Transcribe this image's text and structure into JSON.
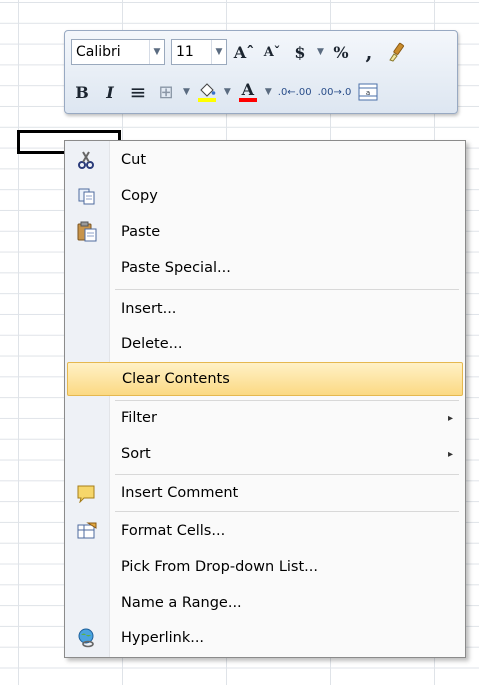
{
  "toolbar": {
    "font_name": "Calibri",
    "font_size": "11",
    "row1_buttons": [
      {
        "name": "grow-font-button",
        "glyph": "Aˆ"
      },
      {
        "name": "shrink-font-button",
        "glyph": "Aˇ"
      },
      {
        "name": "currency-button",
        "glyph": "$"
      },
      {
        "name": "percent-button",
        "glyph": "%"
      },
      {
        "name": "comma-button",
        "glyph": ","
      }
    ],
    "row2_buttons": [
      {
        "name": "bold-button",
        "glyph": "B"
      },
      {
        "name": "italic-button",
        "glyph": "I"
      },
      {
        "name": "center-button",
        "glyph": "≡"
      },
      {
        "name": "borders-button",
        "glyph": "⊞"
      }
    ],
    "fill_color": "#ffff00",
    "font_color": "#ff0000",
    "increase_decimal_glyph": ".0←.00",
    "decrease_decimal_glyph": ".00→.0"
  },
  "menu": {
    "items": [
      {
        "label": "Cut",
        "icon": "scissors-icon",
        "glyph": "✂"
      },
      {
        "label": "Copy",
        "icon": "copy-icon",
        "glyph": "⎘"
      },
      {
        "label": "Paste",
        "icon": "paste-icon",
        "glyph": "❐"
      },
      {
        "label": "Paste Special...",
        "icon": "",
        "glyph": ""
      },
      {
        "label": "Insert...",
        "icon": "",
        "glyph": ""
      },
      {
        "label": "Delete...",
        "icon": "",
        "glyph": ""
      },
      {
        "label": "Clear Contents",
        "icon": "",
        "glyph": ""
      },
      {
        "label": "Filter",
        "icon": "",
        "glyph": "",
        "submenu": "▸"
      },
      {
        "label": "Sort",
        "icon": "",
        "glyph": "",
        "submenu": "▸"
      },
      {
        "label": "Insert Comment",
        "icon": "comment-icon",
        "glyph": "✉"
      },
      {
        "label": "Format Cells...",
        "icon": "format-cells-icon",
        "glyph": "▦"
      },
      {
        "label": "Pick From Drop-down List...",
        "icon": "",
        "glyph": ""
      },
      {
        "label": "Name a Range...",
        "icon": "",
        "glyph": ""
      },
      {
        "label": "Hyperlink...",
        "icon": "hyperlink-icon",
        "glyph": "⊕"
      }
    ],
    "highlight_color": "#fbd983"
  }
}
